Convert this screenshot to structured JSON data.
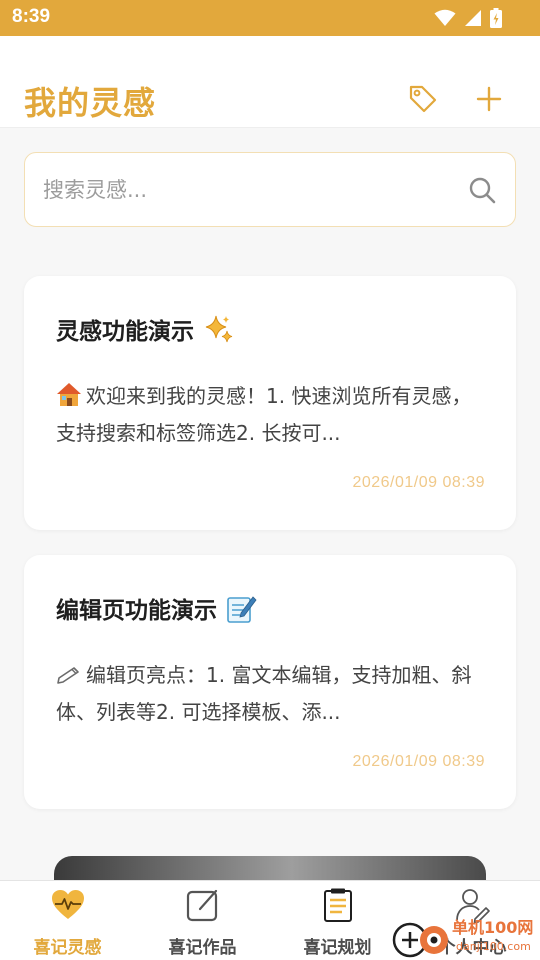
{
  "status_bar": {
    "time": "8:39"
  },
  "header": {
    "title": "我的灵感"
  },
  "search": {
    "placeholder": "搜索灵感..."
  },
  "cards": [
    {
      "title": "灵感功能演示",
      "emoji": "sparkles-icon",
      "body": "欢迎来到我的灵感！1. 快速浏览所有灵感，支持搜索和标签筛选2. 长按可...",
      "body_icon": "house-icon",
      "date": "2026/01/09 08:39"
    },
    {
      "title": "编辑页功能演示",
      "emoji": "memo-icon",
      "body": "编辑页亮点：1. 富文本编辑，支持加粗、斜体、列表等2. 可选择模板、添...",
      "body_icon": "pencil-icon",
      "date": "2026/01/09 08:39"
    }
  ],
  "tabs": [
    {
      "label": "喜记灵感",
      "icon": "heart-pulse-icon",
      "active": true
    },
    {
      "label": "喜记作品",
      "icon": "edit-square-icon",
      "active": false
    },
    {
      "label": "喜记规划",
      "icon": "clipboard-icon",
      "active": false
    },
    {
      "label": "个人中心",
      "icon": "profile-icon",
      "active": false
    }
  ],
  "watermark": {
    "text": "单机100网",
    "url": "danji100.com"
  },
  "colors": {
    "accent": "#e2a83c",
    "date": "#f0c98a",
    "background": "#f7f7f7"
  }
}
